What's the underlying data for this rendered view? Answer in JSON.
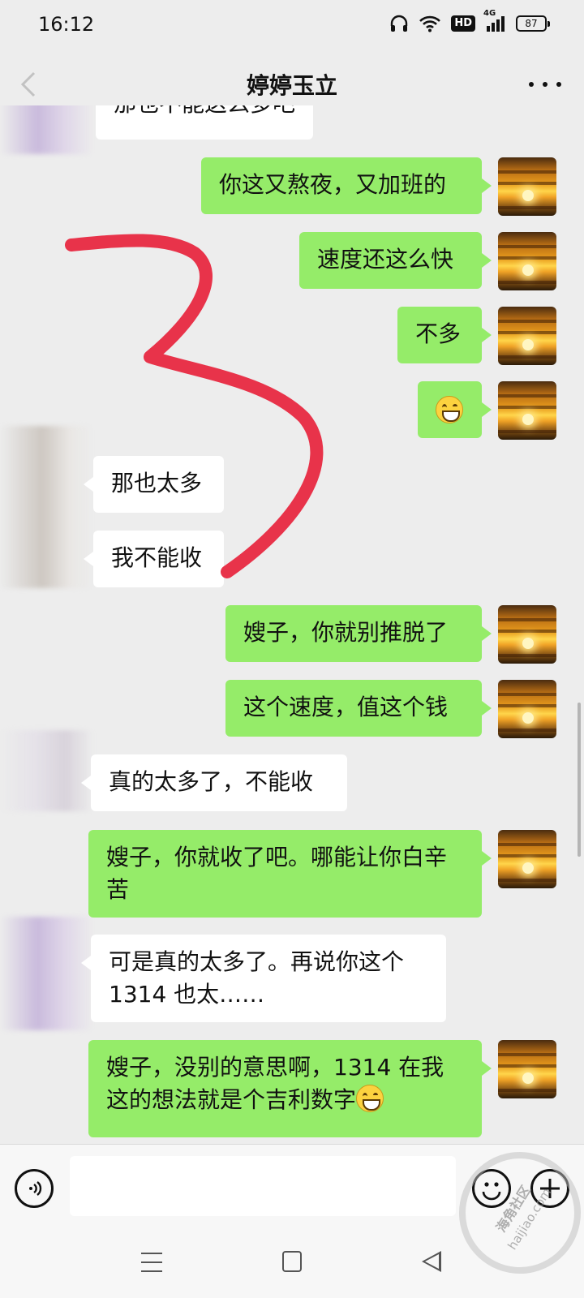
{
  "status": {
    "time": "16:12",
    "hd_label": "HD",
    "network_label": "4G",
    "battery": "87"
  },
  "header": {
    "title": "婷婷玉立",
    "back_icon": "chevron-left-icon",
    "more_icon": "more-dots-icon"
  },
  "messages": [
    {
      "from": "them",
      "text": "那也不能这么多吧",
      "partial": true
    },
    {
      "from": "me",
      "text": "你这又熬夜，又加班的"
    },
    {
      "from": "me",
      "text": "速度还这么快"
    },
    {
      "from": "me",
      "text": "不多"
    },
    {
      "from": "me",
      "emoji": "grin-emoji"
    },
    {
      "from": "them",
      "text": "那也太多"
    },
    {
      "from": "them",
      "text": "我不能收"
    },
    {
      "from": "me",
      "text": "嫂子，你就别推脱了"
    },
    {
      "from": "me",
      "text": "这个速度，值这个钱"
    },
    {
      "from": "them",
      "text": "真的太多了，不能收"
    },
    {
      "from": "me",
      "text": "嫂子，你就收了吧。哪能让你白辛苦"
    },
    {
      "from": "them",
      "text": "可是真的太多了。再说你这个1314  也太……"
    },
    {
      "from": "me",
      "text": "嫂子，没别的意思啊，1314 在我这的想法就是个吉利数字"
    }
  ],
  "annotation": {
    "label": "3",
    "color": "#e8334a"
  },
  "input_bar": {
    "placeholder": "",
    "voice_icon": "voice-icon",
    "emoji_icon": "emoji-icon",
    "plus_icon": "plus-icon"
  },
  "watermark": {
    "line1": "海角社区",
    "line2": "haijiao.com"
  },
  "colors": {
    "my_bubble": "#95ec69",
    "their_bubble": "#ffffff",
    "background": "#ededed"
  }
}
